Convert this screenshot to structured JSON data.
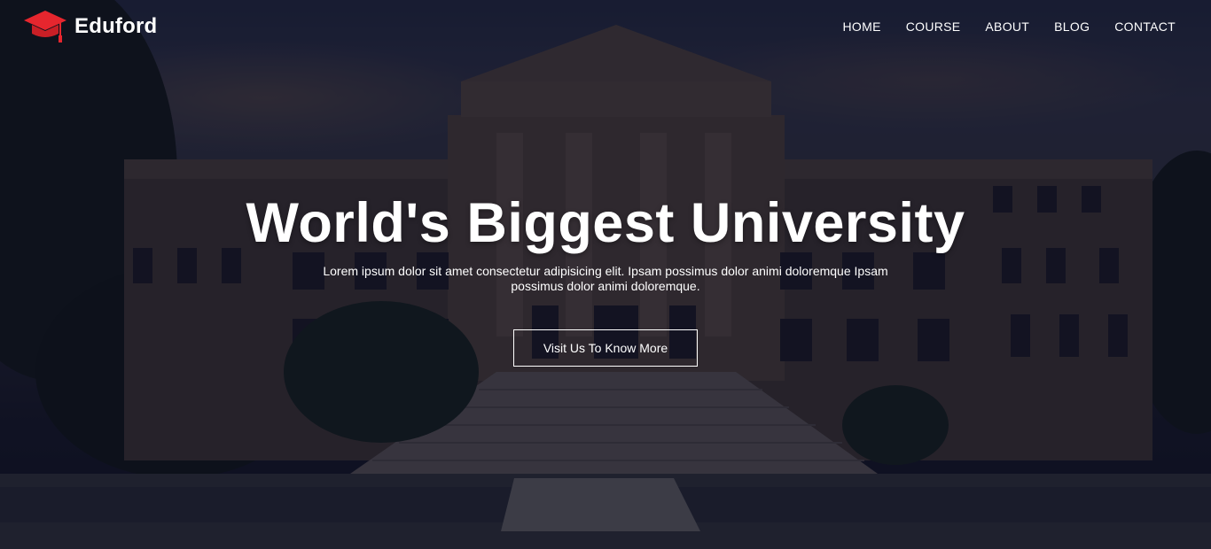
{
  "brand": {
    "name": "Eduford",
    "icon": "graduation-cap-icon",
    "icon_color": "#e6262e"
  },
  "nav": {
    "items": [
      {
        "label": "HOME"
      },
      {
        "label": "COURSE"
      },
      {
        "label": "ABOUT"
      },
      {
        "label": "BLOG"
      },
      {
        "label": "CONTACT"
      }
    ]
  },
  "hero": {
    "title": "World's Biggest University",
    "subtitle": "Lorem ipsum dolor sit amet consectetur adipisicing elit. Ipsam possimus dolor animi doloremque Ipsam possimus dolor animi doloremque.",
    "cta_label": "Visit Us To Know More"
  }
}
